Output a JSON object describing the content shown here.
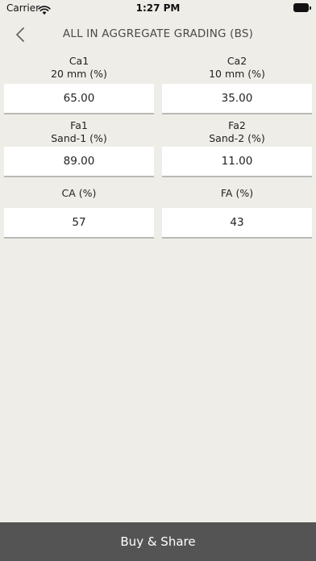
{
  "status_bar": {
    "carrier": "Carrier",
    "time": "1:27 PM"
  },
  "nav": {
    "title": "ALL IN AGGREGATE GRADING (BS)",
    "back_icon": "chevron-left-icon"
  },
  "fields": [
    {
      "label_line1": "Ca1",
      "label_line2": "20 mm (%)",
      "value": "65.00"
    },
    {
      "label_line1": "Ca2",
      "label_line2": "10 mm (%)",
      "value": "35.00"
    },
    {
      "label_line1": "Fa1",
      "label_line2": "Sand-1 (%)",
      "value": "89.00"
    },
    {
      "label_line1": "Fa2",
      "label_line2": "Sand-2 (%)",
      "value": "11.00"
    },
    {
      "label_line1": "CA (%)",
      "label_line2": "",
      "value": "57"
    },
    {
      "label_line1": "FA (%)",
      "label_line2": "",
      "value": "43"
    }
  ],
  "bottom_bar": {
    "label": "Buy & Share"
  },
  "colors": {
    "background": "#eeede8",
    "bottom_bar": "#545454",
    "input_background": "#ffffff"
  }
}
